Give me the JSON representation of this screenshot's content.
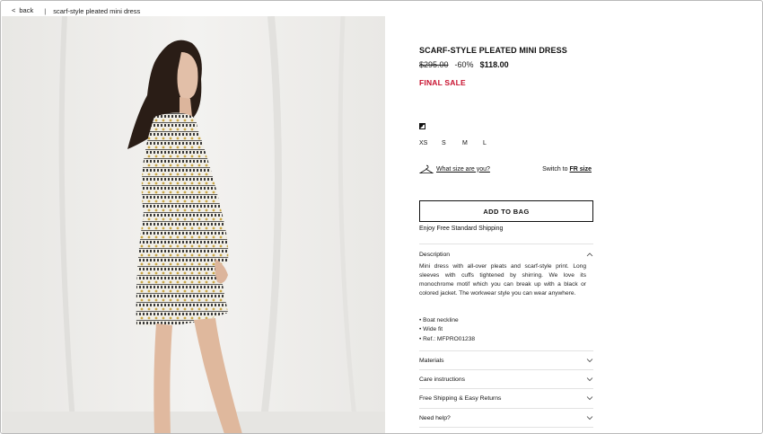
{
  "breadcrumb": {
    "back_label": "back",
    "separator": "|",
    "current": "scarf-style pleated mini dress"
  },
  "product": {
    "title": "SCARF-STYLE PLEATED MINI DRESS",
    "old_price": "$295.00",
    "discount": "-60%",
    "price": "$118.00",
    "badge": "FINAL SALE",
    "sizes": [
      "XS",
      "S",
      "M",
      "L"
    ]
  },
  "size_guide": {
    "what_size": "What size are you?",
    "switch_prefix": "Switch to",
    "switch_link": "FR size"
  },
  "cta": {
    "add_to_bag": "ADD TO BAG",
    "shipping_note": "Enjoy Free Standard Shipping"
  },
  "accordion": {
    "description": {
      "label": "Description",
      "text": "Mini dress with all-over pleats and scarf-style print. Long sleeves with cuffs tightened by shirring. We love its monochrome motif which you can break up with a black or colored jacket. The workwear style you can wear anywhere.",
      "bullets": [
        "• Boat neckline",
        "• Wide fit",
        "• Ref.: MFPRO01238"
      ]
    },
    "sections": [
      "Materials",
      "Care instructions",
      "Free Shipping & Easy Returns",
      "Need help?"
    ]
  },
  "colors": {
    "sale_red": "#c8102e",
    "text": "#111111",
    "backdrop": "#ededec"
  }
}
